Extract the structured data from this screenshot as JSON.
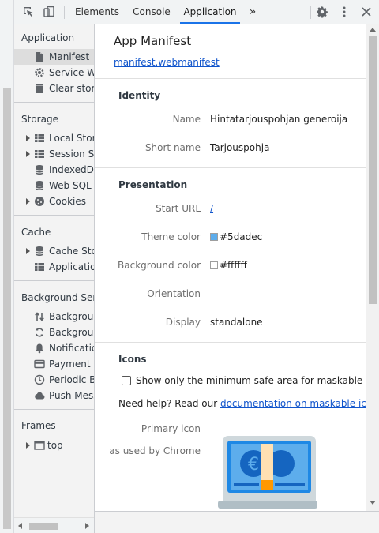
{
  "toolbar": {
    "tabs": [
      "Elements",
      "Console",
      "Application"
    ],
    "active_tab": "Application",
    "more_glyph": "»",
    "icons": [
      "inspect-element-icon",
      "device-toolbar-icon",
      "gear-icon",
      "kebab-menu-icon",
      "close-icon"
    ]
  },
  "sidebar": {
    "application": {
      "header": "Application",
      "items": [
        {
          "label": "Manifest",
          "icon": "document-icon"
        },
        {
          "label": "Service Workers",
          "icon": "gear-icon"
        },
        {
          "label": "Clear storage",
          "icon": "trash-icon"
        }
      ]
    },
    "storage": {
      "header": "Storage",
      "items": [
        {
          "label": "Local Storage",
          "icon": "grid-icon"
        },
        {
          "label": "Session Storage",
          "icon": "grid-icon"
        },
        {
          "label": "IndexedDB",
          "icon": "database-icon"
        },
        {
          "label": "Web SQL",
          "icon": "database-icon"
        },
        {
          "label": "Cookies",
          "icon": "cookie-icon"
        }
      ]
    },
    "cache": {
      "header": "Cache",
      "items": [
        {
          "label": "Cache Storage",
          "icon": "database-icon"
        },
        {
          "label": "Application Cache",
          "icon": "grid-icon"
        }
      ]
    },
    "background": {
      "header": "Background Services",
      "items": [
        {
          "label": "Background Fetch",
          "icon": "updown-arrows-icon"
        },
        {
          "label": "Background Sync",
          "icon": "sync-icon"
        },
        {
          "label": "Notifications",
          "icon": "bell-icon"
        },
        {
          "label": "Payment Handler",
          "icon": "card-icon"
        },
        {
          "label": "Periodic Background Sync",
          "icon": "clock-icon"
        },
        {
          "label": "Push Messaging",
          "icon": "cloud-icon"
        }
      ]
    },
    "frames": {
      "header": "Frames",
      "items": [
        {
          "label": "top",
          "icon": "frame-icon"
        }
      ]
    }
  },
  "manifest": {
    "title": "App Manifest",
    "link": "manifest.webmanifest",
    "identity": {
      "header": "Identity",
      "name_label": "Name",
      "name": "Hintatarjouspohjan generoija",
      "short_name_label": "Short name",
      "short_name": "Tarjouspohja"
    },
    "presentation": {
      "header": "Presentation",
      "start_url_label": "Start URL",
      "start_url": "/",
      "theme_color_label": "Theme color",
      "theme_color": "#5dadec",
      "background_color_label": "Background color",
      "background_color": "#ffffff",
      "orientation_label": "Orientation",
      "orientation": "",
      "display_label": "Display",
      "display": "standalone"
    },
    "icons": {
      "header": "Icons",
      "checkbox_label": "Show only the minimum safe area for maskable icons",
      "help_prefix": "Need help? Read our ",
      "help_link": "documentation on maskable icons",
      "help_suffix": ".",
      "primary_icon_label": "Primary icon",
      "primary_icon_sub": "as used by Chrome"
    }
  },
  "colors": {
    "accent": "#1a73e8",
    "link": "#1155cc",
    "theme_swatch": "#5dadec",
    "background_swatch": "#ffffff"
  }
}
